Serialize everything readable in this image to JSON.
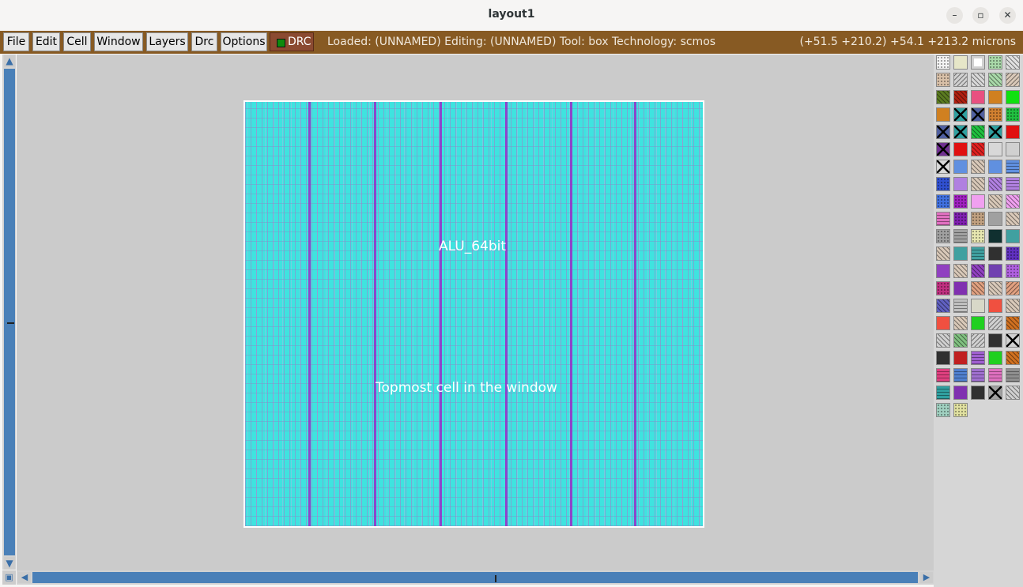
{
  "window": {
    "title": "layout1",
    "minimize": "–",
    "maximize": "▫",
    "close": "✕"
  },
  "menu": {
    "items": [
      {
        "label": "File",
        "name": "menu-file"
      },
      {
        "label": "Edit",
        "name": "menu-edit"
      },
      {
        "label": "Cell",
        "name": "menu-cell"
      },
      {
        "label": "Window",
        "name": "menu-window"
      },
      {
        "label": "Layers",
        "name": "menu-layers"
      },
      {
        "label": "Drc",
        "name": "menu-drc"
      },
      {
        "label": "Options",
        "name": "menu-options"
      }
    ],
    "drc_label": "DRC",
    "drc_indicator_color": "#0e8a0e"
  },
  "status": {
    "text": "Loaded: (UNNAMED) Editing: (UNNAMED) Tool: box  Technology: scmos",
    "coords": "(+51.5 +210.2) +54.1 +213.2 microns"
  },
  "layout": {
    "cell_name": "ALU_64bit",
    "note": "Topmost cell in the window",
    "fill_color": "#3fe3df",
    "stripe_color": "#9a2ac8"
  },
  "scroll": {
    "up_icon": "arrow-up-icon",
    "down_icon": "arrow-down-icon",
    "left_icon": "arrow-left-icon",
    "right_icon": "arrow-right-icon"
  },
  "palette": {
    "swatches": [
      {
        "bg": "#f2f2f2",
        "pat": "dots"
      },
      {
        "bg": "#e6e6c8",
        "pat": "solid"
      },
      {
        "bg": "#d0d0d0",
        "pat": "box"
      },
      {
        "bg": "#a8d8a8",
        "pat": "dots"
      },
      {
        "bg": "#e0e0e0",
        "pat": "diag"
      },
      {
        "bg": "#d8c0a8",
        "pat": "dots"
      },
      {
        "bg": "#d0d0d0",
        "pat": "diag2"
      },
      {
        "bg": "#d8d8d8",
        "pat": "diag"
      },
      {
        "bg": "#a8d8a8",
        "pat": "diag"
      },
      {
        "bg": "#d8c8b8",
        "pat": "diag2"
      },
      {
        "bg": "#5a7a20",
        "pat": "diag"
      },
      {
        "bg": "#b02010",
        "pat": "diag"
      },
      {
        "bg": "#e85080",
        "pat": "solid"
      },
      {
        "bg": "#d08020",
        "pat": "solid"
      },
      {
        "bg": "#10e010",
        "pat": "solid"
      },
      {
        "bg": "#d08020",
        "pat": "solid"
      },
      {
        "bg": "#30a0a0",
        "pat": "cross"
      },
      {
        "bg": "#5060a0",
        "pat": "cross"
      },
      {
        "bg": "#d08030",
        "pat": "dots"
      },
      {
        "bg": "#20c040",
        "pat": "dots"
      },
      {
        "bg": "#5060a0",
        "pat": "cross"
      },
      {
        "bg": "#30a0a0",
        "pat": "cross"
      },
      {
        "bg": "#20c040",
        "pat": "diag"
      },
      {
        "bg": "#30a0a0",
        "pat": "cross"
      },
      {
        "bg": "#e01010",
        "pat": "solid"
      },
      {
        "bg": "#703090",
        "pat": "cross"
      },
      {
        "bg": "#e01010",
        "pat": "solid"
      },
      {
        "bg": "#e02020",
        "pat": "diag"
      },
      {
        "bg": "#d8d8d8",
        "pat": "solid"
      },
      {
        "bg": "#d0d0d0",
        "pat": "solid"
      },
      {
        "bg": "#d8d8d8",
        "pat": "cross"
      },
      {
        "bg": "#6090e0",
        "pat": "solid"
      },
      {
        "bg": "#d8c8b8",
        "pat": "diag"
      },
      {
        "bg": "#6090e0",
        "pat": "solid"
      },
      {
        "bg": "#6090e0",
        "pat": "hlines"
      },
      {
        "bg": "#3050d0",
        "pat": "dots"
      },
      {
        "bg": "#b080e0",
        "pat": "solid"
      },
      {
        "bg": "#d8c8b8",
        "pat": "diag"
      },
      {
        "bg": "#b080e0",
        "pat": "diag"
      },
      {
        "bg": "#b080e0",
        "pat": "hlines"
      },
      {
        "bg": "#4070e0",
        "pat": "dots"
      },
      {
        "bg": "#a020c0",
        "pat": "dots"
      },
      {
        "bg": "#f0a0f0",
        "pat": "solid"
      },
      {
        "bg": "#d8c8b8",
        "pat": "diag"
      },
      {
        "bg": "#f0a0f0",
        "pat": "diag"
      },
      {
        "bg": "#e070c0",
        "pat": "hlines"
      },
      {
        "bg": "#8020b0",
        "pat": "dots"
      },
      {
        "bg": "#c0a080",
        "pat": "dots"
      },
      {
        "bg": "#a0a0a0",
        "pat": "solid"
      },
      {
        "bg": "#d8c8b8",
        "pat": "diag"
      },
      {
        "bg": "#a0a0a0",
        "pat": "dots"
      },
      {
        "bg": "#a0a0a0",
        "pat": "hlines"
      },
      {
        "bg": "#e6e6b0",
        "pat": "dots"
      },
      {
        "bg": "#103030",
        "pat": "solid"
      },
      {
        "bg": "#40a0a0",
        "pat": "solid"
      },
      {
        "bg": "#d8c8b8",
        "pat": "diag"
      },
      {
        "bg": "#40a0a0",
        "pat": "solid"
      },
      {
        "bg": "#40a0a0",
        "pat": "hlines"
      },
      {
        "bg": "#303030",
        "pat": "solid"
      },
      {
        "bg": "#6030c0",
        "pat": "dots"
      },
      {
        "bg": "#9040c0",
        "pat": "solid"
      },
      {
        "bg": "#d8c8b8",
        "pat": "diag"
      },
      {
        "bg": "#9040c0",
        "pat": "diag"
      },
      {
        "bg": "#7040b0",
        "pat": "solid"
      },
      {
        "bg": "#b060e0",
        "pat": "dots"
      },
      {
        "bg": "#c03080",
        "pat": "dots"
      },
      {
        "bg": "#8030b0",
        "pat": "solid"
      },
      {
        "bg": "#e0a080",
        "pat": "diag"
      },
      {
        "bg": "#d8c8b8",
        "pat": "diag"
      },
      {
        "bg": "#e0a080",
        "pat": "diag2"
      },
      {
        "bg": "#6060c0",
        "pat": "diag"
      },
      {
        "bg": "#c0c0c0",
        "pat": "hlines"
      },
      {
        "bg": "#d8d8c8",
        "pat": "solid"
      },
      {
        "bg": "#f05040",
        "pat": "solid"
      },
      {
        "bg": "#d8c8b8",
        "pat": "diag"
      },
      {
        "bg": "#f05040",
        "pat": "solid"
      },
      {
        "bg": "#d8c8b8",
        "pat": "diag"
      },
      {
        "bg": "#20d020",
        "pat": "solid"
      },
      {
        "bg": "#d0d0d0",
        "pat": "diag2"
      },
      {
        "bg": "#d07020",
        "pat": "diag"
      },
      {
        "bg": "#d0d0d0",
        "pat": "diag"
      },
      {
        "bg": "#80c080",
        "pat": "diag"
      },
      {
        "bg": "#d0d0d0",
        "pat": "diag2"
      },
      {
        "bg": "#303030",
        "pat": "solid"
      },
      {
        "bg": "#d0d0d0",
        "pat": "cross"
      },
      {
        "bg": "#303030",
        "pat": "solid"
      },
      {
        "bg": "#c02020",
        "pat": "solid"
      },
      {
        "bg": "#a060d0",
        "pat": "hlines"
      },
      {
        "bg": "#20d020",
        "pat": "solid"
      },
      {
        "bg": "#d07020",
        "pat": "diag"
      },
      {
        "bg": "#e04080",
        "pat": "hlines"
      },
      {
        "bg": "#5080d0",
        "pat": "hlines"
      },
      {
        "bg": "#a070d0",
        "pat": "hlines"
      },
      {
        "bg": "#e070c0",
        "pat": "hlines"
      },
      {
        "bg": "#909090",
        "pat": "hlines"
      },
      {
        "bg": "#30a0a0",
        "pat": "hlines"
      },
      {
        "bg": "#8030b0",
        "pat": "solid"
      },
      {
        "bg": "#303030",
        "pat": "solid"
      },
      {
        "bg": "#a0a0a0",
        "pat": "cross"
      },
      {
        "bg": "#d0d0d0",
        "pat": "diag"
      },
      {
        "bg": "#a0d0c0",
        "pat": "dots"
      },
      {
        "bg": "#e0e0a0",
        "pat": "dots"
      }
    ]
  }
}
